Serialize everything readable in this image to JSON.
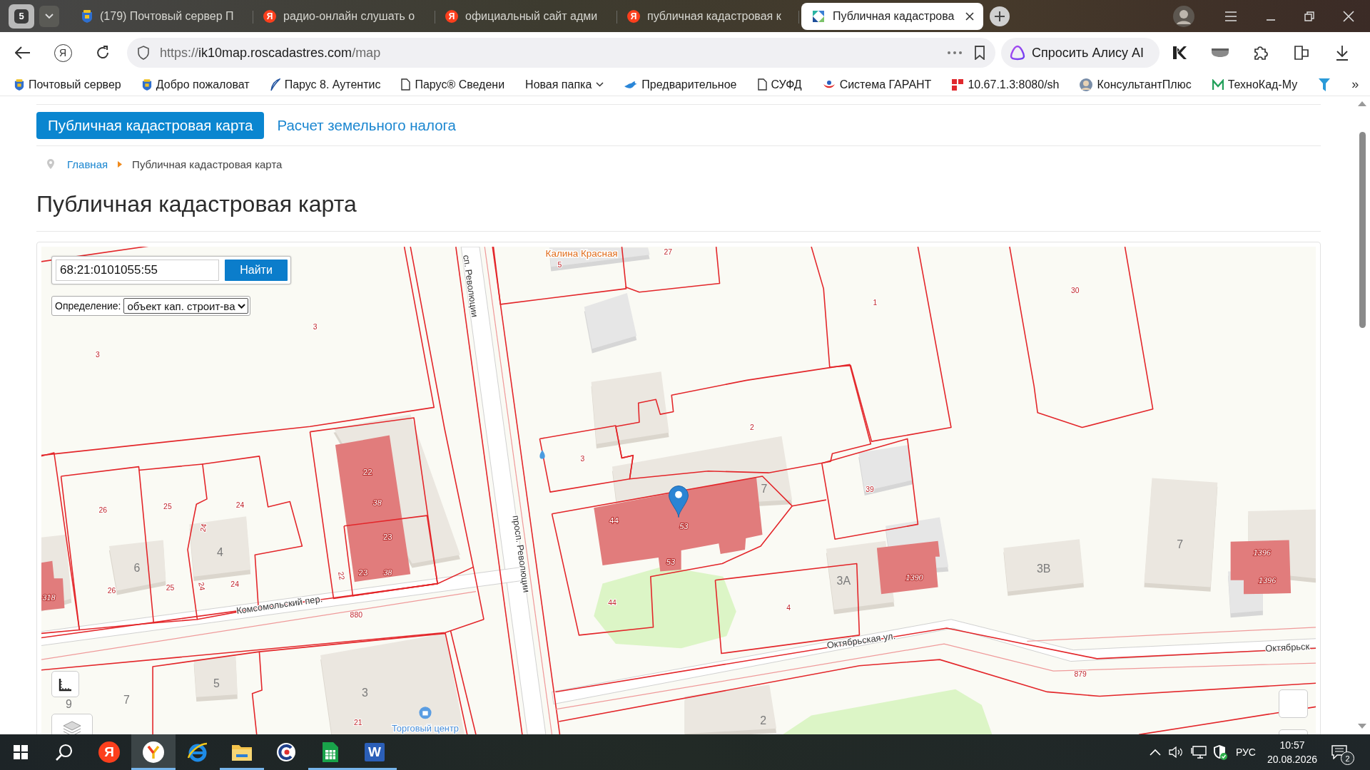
{
  "browser": {
    "tab_group": {
      "count": "5"
    },
    "tabs": [
      {
        "title": "(179) Почтовый сервер П",
        "kind": "emblem",
        "selected": false
      },
      {
        "title": "радио-онлайн слушать о",
        "kind": "yandex",
        "letter": "Я",
        "selected": false
      },
      {
        "title": "официальный сайт адми",
        "kind": "yandex",
        "letter": "Я",
        "selected": false
      },
      {
        "title": "публичная кадастровая к",
        "kind": "yandex",
        "letter": "Я",
        "selected": false
      },
      {
        "title": "Публичная кадастрова",
        "kind": "cadastre",
        "selected": true
      }
    ],
    "home_letter": "Я",
    "address": {
      "scheme": "https://",
      "host": "ik10map.roscadastres.com",
      "path": "/map"
    },
    "assistant": "Спросить Алису AI",
    "bookmarks": [
      {
        "label": "Почтовый сервер",
        "kind": "emblem"
      },
      {
        "label": "Добро пожаловат",
        "kind": "emblem"
      },
      {
        "label": "Парус 8. Аутентис",
        "kind": "feather"
      },
      {
        "label": "Парус® Сведени",
        "kind": "document"
      },
      {
        "label": "Новая папка",
        "kind": "folder"
      },
      {
        "label": "Предварительное",
        "kind": "bird"
      },
      {
        "label": "СУФД",
        "kind": "document"
      },
      {
        "label": "Система ГАРАНТ",
        "kind": "swoosh"
      },
      {
        "label": "10.67.1.3:8080/sh",
        "kind": "squares"
      },
      {
        "label": "КонсультантПлюс",
        "kind": "avatar"
      },
      {
        "label": "ТехноКад-Му",
        "kind": "zigzag"
      }
    ],
    "bookmarks_more": "»"
  },
  "page": {
    "nav": [
      {
        "label": "Публичная кадастровая карта",
        "selected": true
      },
      {
        "label": "Расчет земельного налога",
        "selected": false
      }
    ],
    "breadcrumbs": [
      {
        "label": "Главная",
        "kind": "link"
      },
      {
        "label": "Публичная кадастровая карта",
        "kind": "current"
      }
    ],
    "title": "Публичная кадастровая карта",
    "map": {
      "search": {
        "value": "68:21:0101055:55",
        "button": "Найти"
      },
      "mode": {
        "label": "Определение:",
        "value": "объект кап. строит-ва"
      },
      "labels": [
        {
          "text": "3",
          "kind": "parcel"
        },
        {
          "text": "3",
          "kind": "parcel"
        },
        {
          "text": "сп. Революции",
          "kind": "street"
        },
        {
          "text": "Калина Красная",
          "kind": "poi"
        },
        {
          "text": "5",
          "kind": "parcel"
        },
        {
          "text": "27",
          "kind": "parcel"
        },
        {
          "text": "1",
          "kind": "parcel"
        },
        {
          "text": "30",
          "kind": "parcel"
        },
        {
          "text": "3",
          "kind": "parcel"
        },
        {
          "text": "2",
          "kind": "parcel"
        },
        {
          "text": "7",
          "kind": "building"
        },
        {
          "text": "39",
          "kind": "parcel"
        },
        {
          "text": "44",
          "kind": "marked"
        },
        {
          "text": "53",
          "kind": "area"
        },
        {
          "text": "53",
          "kind": "area"
        },
        {
          "text": "44",
          "kind": "parcel"
        },
        {
          "text": "4",
          "kind": "parcel"
        },
        {
          "text": "3А",
          "kind": "building"
        },
        {
          "text": "1390",
          "kind": "area"
        },
        {
          "text": "3В",
          "kind": "building"
        },
        {
          "text": "7",
          "kind": "building"
        },
        {
          "text": "1396",
          "kind": "area"
        },
        {
          "text": "1396",
          "kind": "area"
        },
        {
          "text": "Октябрьская ул.",
          "kind": "street"
        },
        {
          "text": "879",
          "kind": "parcel"
        },
        {
          "text": "Октябрьск",
          "kind": "street"
        },
        {
          "text": "2",
          "kind": "building"
        },
        {
          "text": "26",
          "kind": "parcel"
        },
        {
          "text": "25",
          "kind": "parcel"
        },
        {
          "text": "24",
          "kind": "parcel"
        },
        {
          "text": "24",
          "kind": "parcel"
        },
        {
          "text": "4",
          "kind": "building"
        },
        {
          "text": "6",
          "kind": "building"
        },
        {
          "text": "26",
          "kind": "parcel"
        },
        {
          "text": "25",
          "kind": "parcel"
        },
        {
          "text": "24",
          "kind": "parcel"
        },
        {
          "text": "24",
          "kind": "parcel"
        },
        {
          "text": "22",
          "kind": "marked"
        },
        {
          "text": "38",
          "kind": "area"
        },
        {
          "text": "23",
          "kind": "marked"
        },
        {
          "text": "23",
          "kind": "marked"
        },
        {
          "text": "38",
          "kind": "area"
        },
        {
          "text": "22",
          "kind": "parcel"
        },
        {
          "text": "318",
          "kind": "area"
        },
        {
          "text": "Комсомольский пер.",
          "kind": "street"
        },
        {
          "text": "880",
          "kind": "parcel"
        },
        {
          "text": "5",
          "kind": "building"
        },
        {
          "text": "7",
          "kind": "building"
        },
        {
          "text": "9",
          "kind": "building"
        },
        {
          "text": "3",
          "kind": "building"
        },
        {
          "text": "21",
          "kind": "parcel"
        },
        {
          "text": "Торговый центр",
          "kind": "shop"
        },
        {
          "text": "просп. Революции",
          "kind": "street"
        }
      ]
    }
  },
  "taskbar": {
    "apps": [
      {
        "kind": "yandex",
        "letter": "Я",
        "running": false,
        "selected": false
      },
      {
        "kind": "browser",
        "running": true,
        "selected": true
      },
      {
        "kind": "ie",
        "running": false,
        "selected": false
      },
      {
        "kind": "explorer",
        "running": true,
        "selected": false
      },
      {
        "kind": "cleaner",
        "running": false,
        "selected": false
      },
      {
        "kind": "sheets",
        "running": true,
        "selected": false
      },
      {
        "kind": "word",
        "letter": "W",
        "running": true,
        "selected": false
      }
    ],
    "language": "РУС",
    "time": "10:57",
    "date": "20.08.2026",
    "notifications": "2"
  }
}
